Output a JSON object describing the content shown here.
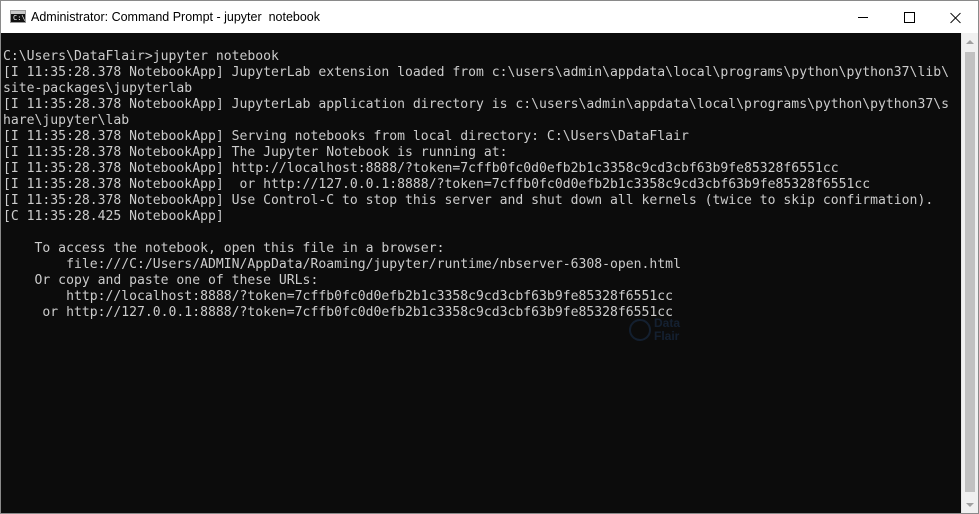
{
  "window": {
    "title": "Administrator: Command Prompt - jupyter  notebook",
    "icon": "cmd-icon",
    "icon_prompt": "C:\\"
  },
  "controls": {
    "minimize": "minimize-icon",
    "maximize": "maximize-icon",
    "close": "close-icon"
  },
  "console": {
    "background": "#0c0c0c",
    "foreground": "#cccccc",
    "lines": [
      "C:\\Users\\DataFlair>jupyter notebook",
      "[I 11:35:28.378 NotebookApp] JupyterLab extension loaded from c:\\users\\admin\\appdata\\local\\programs\\python\\python37\\lib\\",
      "site-packages\\jupyterlab",
      "[I 11:35:28.378 NotebookApp] JupyterLab application directory is c:\\users\\admin\\appdata\\local\\programs\\python\\python37\\s",
      "hare\\jupyter\\lab",
      "[I 11:35:28.378 NotebookApp] Serving notebooks from local directory: C:\\Users\\DataFlair",
      "[I 11:35:28.378 NotebookApp] The Jupyter Notebook is running at:",
      "[I 11:35:28.378 NotebookApp] http://localhost:8888/?token=7cffb0fc0d0efb2b1c3358c9cd3cbf63b9fe85328f6551cc",
      "[I 11:35:28.378 NotebookApp]  or http://127.0.0.1:8888/?token=7cffb0fc0d0efb2b1c3358c9cd3cbf63b9fe85328f6551cc",
      "[I 11:35:28.378 NotebookApp] Use Control-C to stop this server and shut down all kernels (twice to skip confirmation).",
      "[C 11:35:28.425 NotebookApp]",
      "",
      "    To access the notebook, open this file in a browser:",
      "        file:///C:/Users/ADMIN/AppData/Roaming/jupyter/runtime/nbserver-6308-open.html",
      "    Or copy and paste one of these URLs:",
      "        http://localhost:8888/?token=7cffb0fc0d0efb2b1c3358c9cd3cbf63b9fe85328f6551cc",
      "     or http://127.0.0.1:8888/?token=7cffb0fc0d0efb2b1c3358c9cd3cbf63b9fe85328f6551cc"
    ]
  },
  "watermark": {
    "line1": "Data",
    "line2": "Flair"
  }
}
